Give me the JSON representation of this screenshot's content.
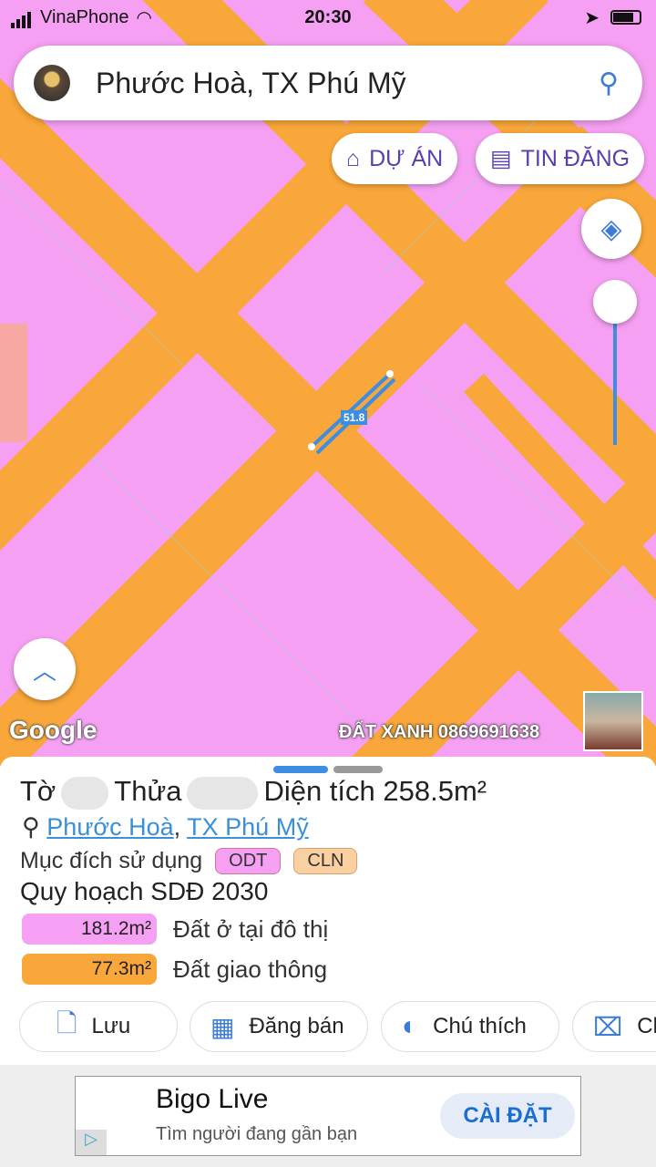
{
  "status_bar": {
    "carrier": "VinaPhone",
    "time": "20:30"
  },
  "search": {
    "query": "Phước Hoà, TX Phú Mỹ",
    "icon": "search-icon"
  },
  "map_buttons": {
    "du_an": "DỰ ÁN",
    "tin_dang": "TIN ĐĂNG"
  },
  "map": {
    "measure_label": "51.8",
    "google": "Google",
    "watermark": "ĐẤT XANH 0869691638",
    "colors": {
      "residential": "#f5a0f2",
      "road": "#f9a73a",
      "measure": "#3d8ee0"
    }
  },
  "parcel": {
    "to_label": "Tờ",
    "thua_label": "Thửa",
    "area_label": "Diện tích 258.5m²",
    "ward": "Phước Hoà",
    "town": "TX Phú Mỹ",
    "purpose_label": "Mục đích sử dụng",
    "purpose_tags": [
      "ODT",
      "CLN"
    ],
    "plan_title": "Quy hoạch SDĐ 2030",
    "plan_items": [
      {
        "area": "181.2m²",
        "label": "Đất ở tại đô thị",
        "color": "#f5a0f2"
      },
      {
        "area": "77.3m²",
        "label": "Đất giao thông",
        "color": "#f9a73a"
      }
    ]
  },
  "actions": [
    "Lưu",
    "Đăng bán",
    "Chú thích",
    "Cl"
  ],
  "ad": {
    "title": "Bigo Live",
    "subtitle": "Tìm người đang gần bạn",
    "cta": "CÀI ĐẶT"
  }
}
